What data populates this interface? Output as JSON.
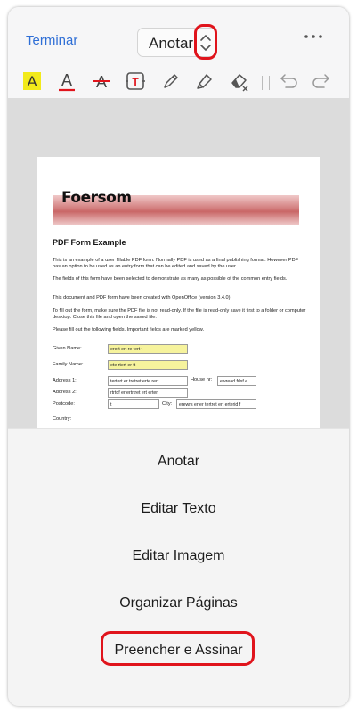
{
  "header": {
    "done_label": "Terminar",
    "mode_label": "Anotar",
    "more_icon": "ellipsis-icon",
    "selector_icon": "chevron-up-down-icon"
  },
  "toolbar": {
    "tools": [
      "highlight-text-icon",
      "underline-text-icon",
      "strikethrough-text-icon",
      "text-box-icon",
      "pen-icon",
      "highlighter-icon",
      "eraser-icon",
      "undo-icon",
      "redo-icon"
    ]
  },
  "document": {
    "logo": "Foersom",
    "title": "PDF Form Example",
    "paragraphs": [
      "This is an example of a user fillable PDF form. Normally PDF is used as a final publishing format. However PDF has an option to be used as an entry form that can be edited and saved by the user.",
      "The fields of this form have been selected to demonstrate as many as possible of the common entry fields.",
      "This document and PDF form have been created with OpenOffice (version 3.4.0).",
      "To fill out the form, make sure the PDF file is not read-only. If the file is read-only save it first to a folder or computer desktop. Close this file and open the saved file.",
      "Please fill out the following fields. Important fields are marked yellow."
    ],
    "fields": {
      "given_name_label": "Given Name:",
      "given_name_value": "erert ert re tert t",
      "family_name_label": "Family Name:",
      "family_name_value": "ete rtert er tt",
      "address1_label": "Address 1:",
      "address1_value": "tertert er tretret  erte rert",
      "house_label": "House nr:",
      "house_value": "ewread fdsf e",
      "address2_label": "Address 2:",
      "address2_value": "rtrtdf ertertrtret ert erter",
      "postcode_label": "Postcode:",
      "postcode_value": "t",
      "city_label": "City:",
      "city_value": "erewrs erter tertret ert erterid f",
      "country_label": "Country:"
    }
  },
  "sheet": {
    "items": [
      "Anotar",
      "Editar Texto",
      "Editar Imagem",
      "Organizar Páginas",
      "Preencher e Assinar"
    ]
  },
  "colors": {
    "accent": "#2f6fd6",
    "highlight_ring": "#e0141c",
    "highlight_yellow": "#f2ea1b",
    "underline_red": "#e0141c"
  }
}
